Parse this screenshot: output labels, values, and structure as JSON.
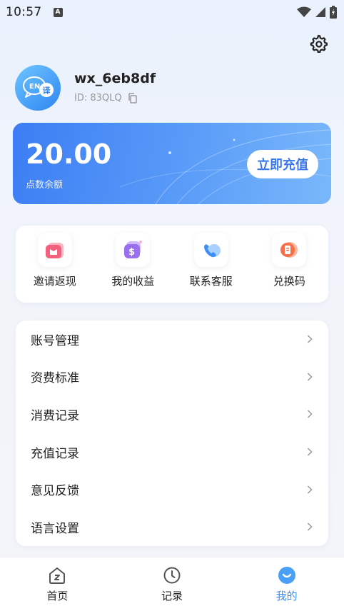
{
  "status_bar": {
    "time": "10:57",
    "notification_icon": "A"
  },
  "profile": {
    "avatar_text_1": "EN",
    "avatar_text_2": "译",
    "username": "wx_6eb8df",
    "user_id": "ID: 83QLQ"
  },
  "balance": {
    "amount": "20.00",
    "label": "点数余额",
    "recharge_label": "立即充值"
  },
  "quick_actions": [
    {
      "label": "邀请返现",
      "icon": "gift-icon",
      "color": "#f2607d"
    },
    {
      "label": "我的收益",
      "icon": "earnings-icon",
      "color": "#9a6ff0"
    },
    {
      "label": "联系客服",
      "icon": "phone-icon",
      "color": "#3d8ff5"
    },
    {
      "label": "兑换码",
      "icon": "coupon-icon",
      "color": "#f57048"
    }
  ],
  "menu": [
    {
      "label": "账号管理"
    },
    {
      "label": "资费标准"
    },
    {
      "label": "消费记录"
    },
    {
      "label": "充值记录"
    },
    {
      "label": "意见反馈"
    },
    {
      "label": "语言设置"
    }
  ],
  "tabbar": [
    {
      "label": "首页",
      "icon": "home-icon"
    },
    {
      "label": "记录",
      "icon": "clock-icon"
    },
    {
      "label": "我的",
      "icon": "profile-icon",
      "active": true
    }
  ],
  "colors": {
    "accent": "#3a8ef3",
    "card_gradient_start": "#3c7df4",
    "card_gradient_end": "#7ab8fb"
  }
}
